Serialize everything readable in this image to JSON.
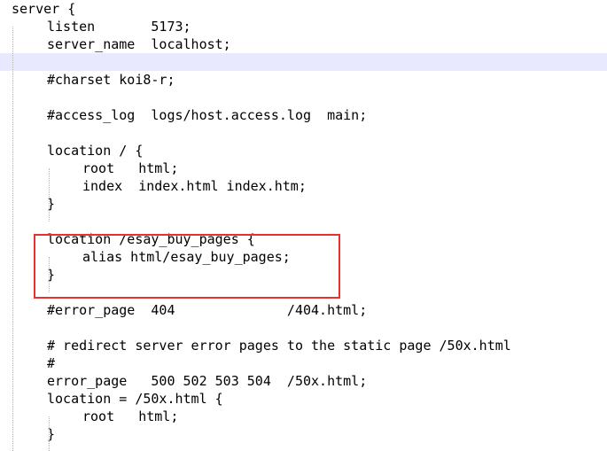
{
  "code_lines": [
    {
      "indent": 0,
      "text": "server {"
    },
    {
      "indent": 1,
      "text": "listen       5173;"
    },
    {
      "indent": 1,
      "text": "server_name  localhost;"
    },
    {
      "indent": 0,
      "text": ""
    },
    {
      "indent": 1,
      "text": "#charset koi8-r;"
    },
    {
      "indent": 0,
      "text": ""
    },
    {
      "indent": 1,
      "text": "#access_log  logs/host.access.log  main;"
    },
    {
      "indent": 0,
      "text": ""
    },
    {
      "indent": 1,
      "text": "location / {"
    },
    {
      "indent": 2,
      "text": "root   html;"
    },
    {
      "indent": 2,
      "text": "index  index.html index.htm;"
    },
    {
      "indent": 1,
      "text": "}"
    },
    {
      "indent": 0,
      "text": ""
    },
    {
      "indent": 1,
      "text": "location /esay_buy_pages {"
    },
    {
      "indent": 2,
      "text": "alias html/esay_buy_pages;"
    },
    {
      "indent": 1,
      "text": "}"
    },
    {
      "indent": 0,
      "text": ""
    },
    {
      "indent": 1,
      "text": "#error_page  404              /404.html;"
    },
    {
      "indent": 0,
      "text": ""
    },
    {
      "indent": 1,
      "text": "# redirect server error pages to the static page /50x.html"
    },
    {
      "indent": 1,
      "text": "#"
    },
    {
      "indent": 1,
      "text": "error_page   500 502 503 504  /50x.html;"
    },
    {
      "indent": 1,
      "text": "location = /50x.html {"
    },
    {
      "indent": 2,
      "text": "root   html;"
    },
    {
      "indent": 1,
      "text": "}"
    }
  ],
  "highlighted_line": 3,
  "colors": {
    "text": "#000000",
    "current_line_bg": "#e8e8ff",
    "callout_border": "#e8312f",
    "indent_guide": "#b5b5b5"
  }
}
